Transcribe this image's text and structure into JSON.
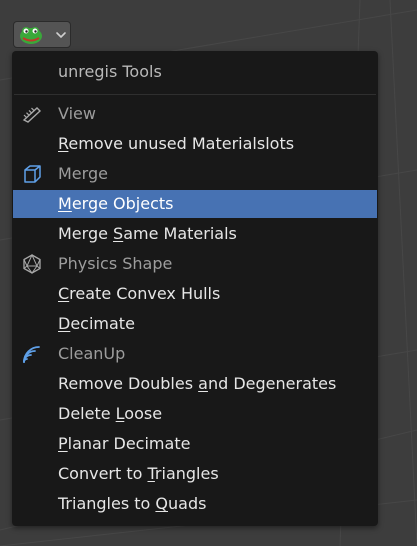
{
  "menu": {
    "title": "unregis Tools",
    "items": [
      {
        "type": "header",
        "icon": "comb-icon",
        "pre": "",
        "u": "",
        "post": "View"
      },
      {
        "type": "item",
        "pre": "",
        "u": "R",
        "post": "emove unused Materialslots"
      },
      {
        "type": "header",
        "icon": "cube-icon",
        "pre": "",
        "u": "",
        "post": "Merge"
      },
      {
        "type": "item",
        "active": true,
        "pre": "",
        "u": "M",
        "post": "erge Objects"
      },
      {
        "type": "item",
        "pre": "Merge ",
        "u": "S",
        "post": "ame Materials"
      },
      {
        "type": "header",
        "icon": "icosphere-icon",
        "pre": "",
        "u": "",
        "post": "Physics Shape"
      },
      {
        "type": "item",
        "pre": "",
        "u": "C",
        "post": "reate Convex Hulls"
      },
      {
        "type": "item",
        "pre": "",
        "u": "D",
        "post": "ecimate"
      },
      {
        "type": "header",
        "icon": "signal-icon",
        "pre": "",
        "u": "",
        "post": "CleanUp"
      },
      {
        "type": "item",
        "pre": "Remove Doubles ",
        "u": "a",
        "post": "nd Degenerates"
      },
      {
        "type": "item",
        "pre": "Delete ",
        "u": "L",
        "post": "oose"
      },
      {
        "type": "item",
        "pre": "",
        "u": "P",
        "post": "lanar Decimate"
      },
      {
        "type": "item",
        "pre": "Convert to ",
        "u": "T",
        "post": "riangles"
      },
      {
        "type": "item",
        "pre": "Triangles to ",
        "u": "Q",
        "post": "uads"
      }
    ]
  },
  "header_button": {
    "icon": "frog-avatar-icon",
    "chevron": "chevron-down-icon"
  },
  "colors": {
    "background": "#3d3d3d",
    "menu": "#181818",
    "highlight": "#4772b3",
    "text": "#e6e6e6",
    "muted": "#9d9d9d"
  }
}
